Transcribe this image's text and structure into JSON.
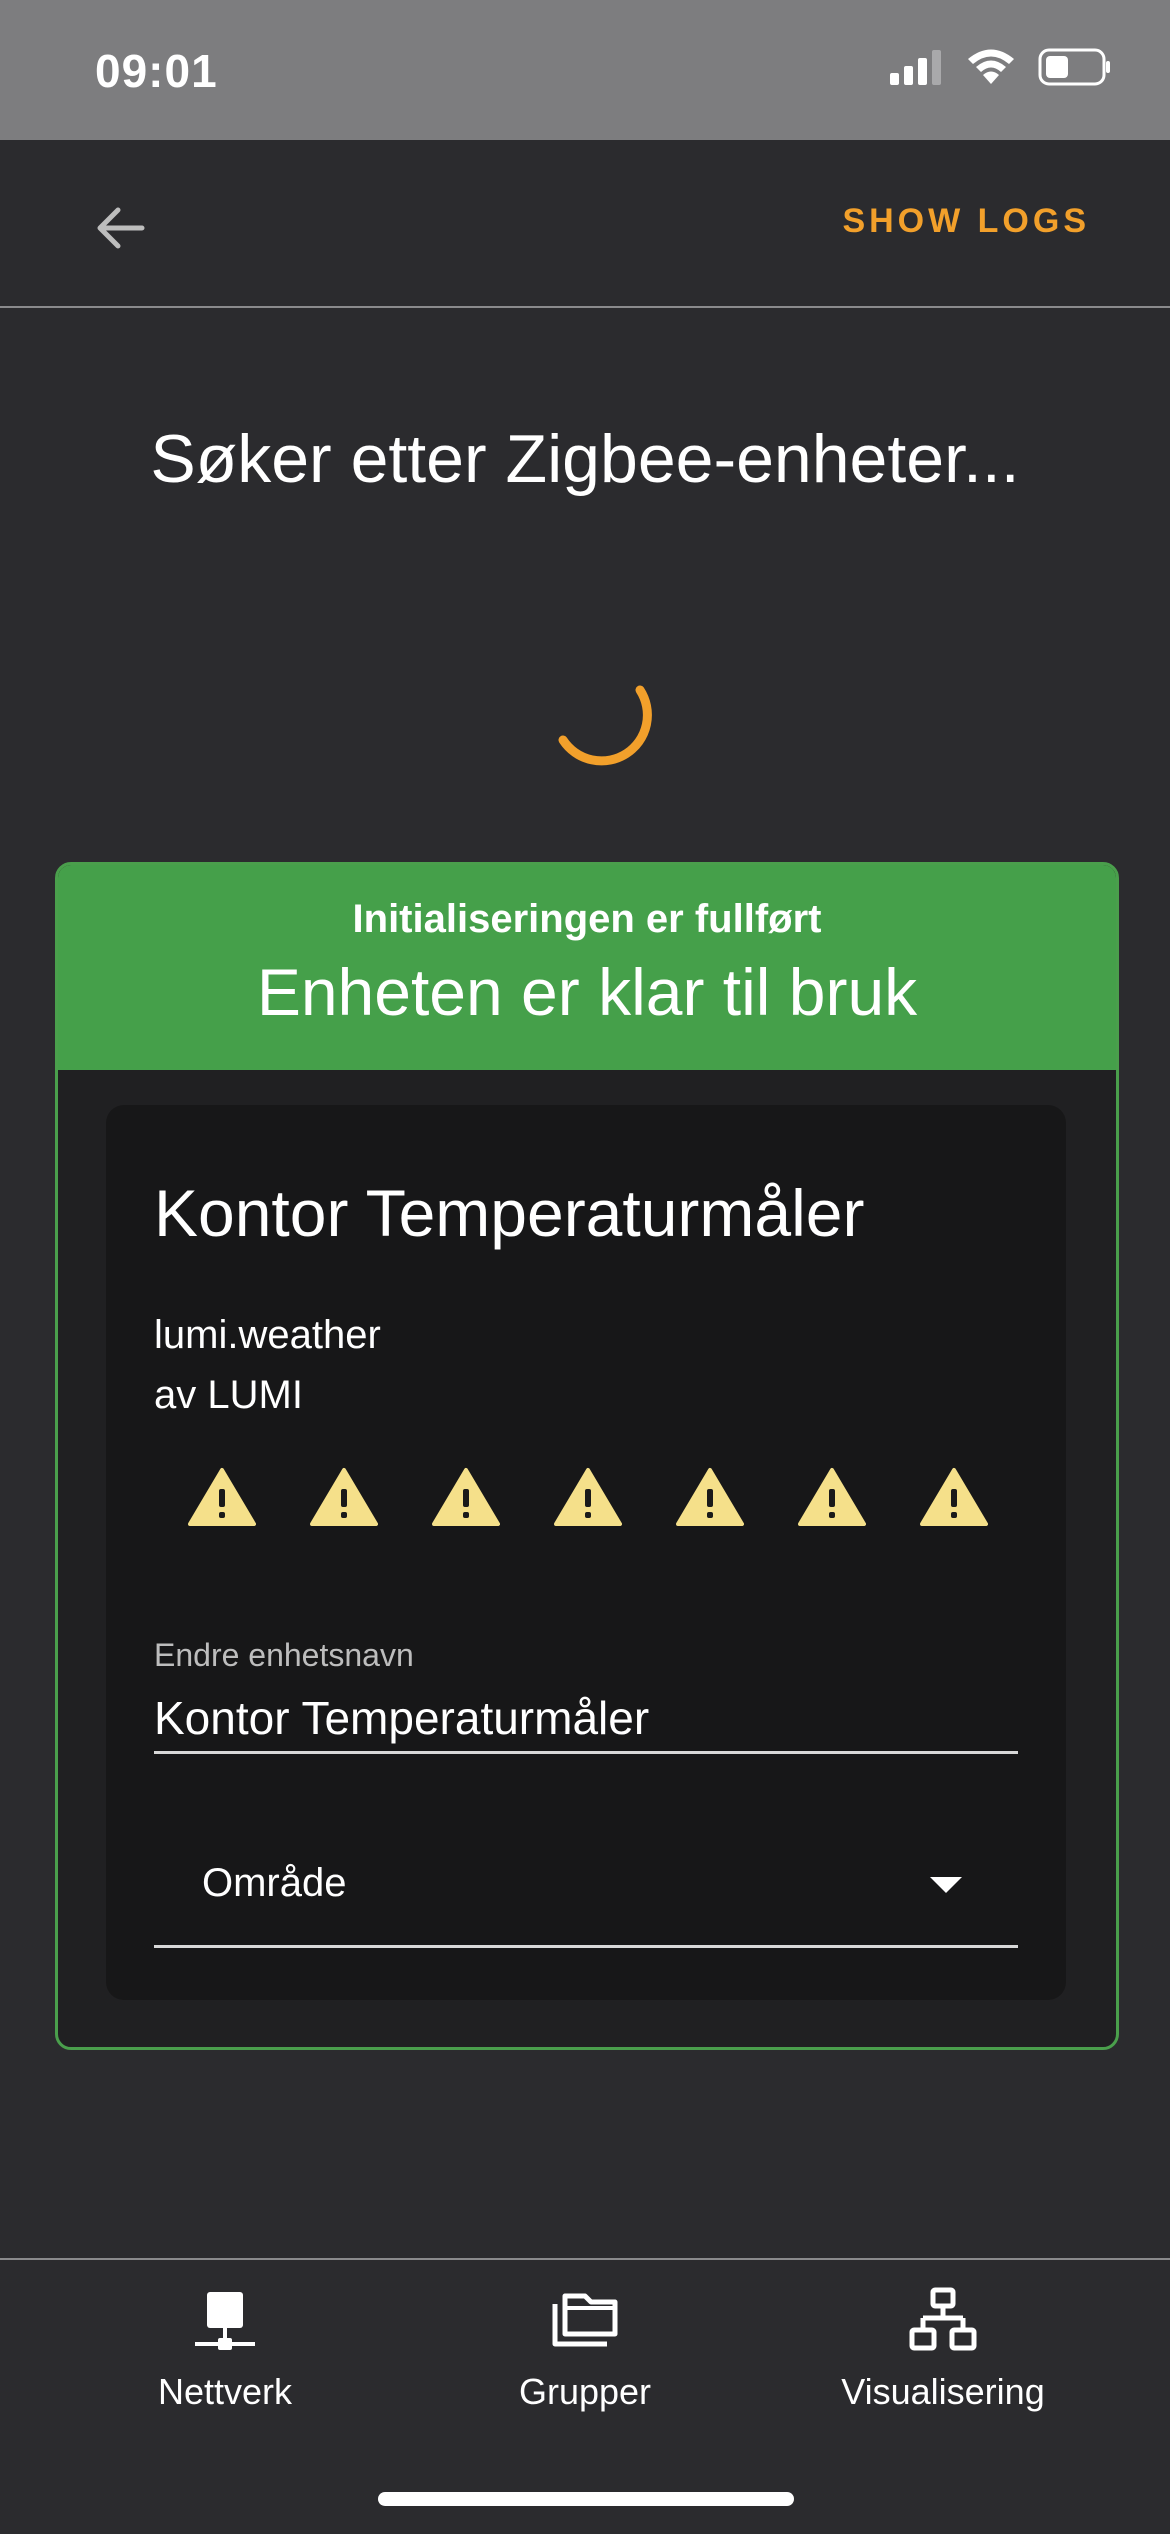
{
  "status_bar": {
    "time": "09:01",
    "icons": [
      "cellular-signal-icon",
      "wifi-icon",
      "battery-icon"
    ]
  },
  "app_bar": {
    "back_icon": "back-arrow-icon",
    "show_logs_label": "SHOW LOGS"
  },
  "page": {
    "title": "Søker etter Zigbee-enheter..."
  },
  "result": {
    "status": "Initialiseringen er fullført",
    "subtitle": "Enheten er klar til bruk"
  },
  "device": {
    "name": "Kontor Temperaturmåler",
    "model": "lumi.weather",
    "manufacturer": "av LUMI",
    "warning_icons": [
      "warning-icon",
      "warning-icon",
      "warning-icon",
      "warning-icon",
      "warning-icon",
      "warning-icon",
      "warning-icon"
    ],
    "rename_label": "Endre enhetsnavn",
    "name_value": "Kontor Temperaturmåler",
    "area_label": "Område"
  },
  "bottom_nav": {
    "items": [
      {
        "label": "Nettverk",
        "icon": "network-icon"
      },
      {
        "label": "Grupper",
        "icon": "groups-icon"
      },
      {
        "label": "Visualisering",
        "icon": "visualization-icon"
      }
    ]
  },
  "colors": {
    "accent": "#f2a02b",
    "success": "#45a04a",
    "warning": "#f5e08a",
    "background": "#2b2b2e",
    "status_bar": "#7d7d7f"
  }
}
